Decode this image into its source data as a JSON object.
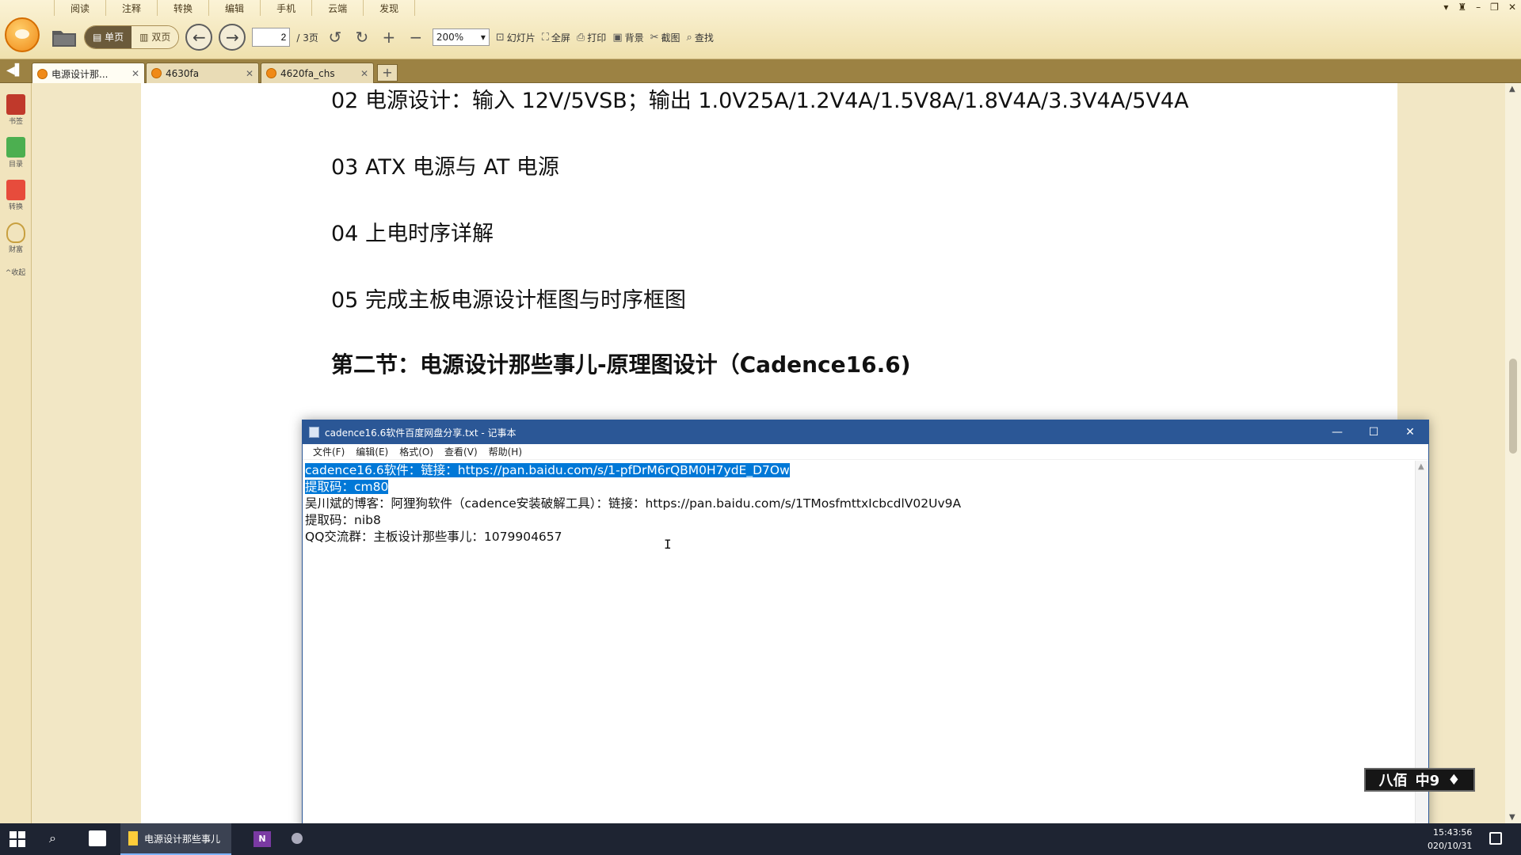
{
  "reader": {
    "menu": [
      "阅读",
      "注释",
      "转换",
      "编辑",
      "手机",
      "云端",
      "发现"
    ],
    "toolbar": {
      "single_page": "单页",
      "double_page": "双页",
      "page_current": "2",
      "page_total": "/ 3页",
      "zoom": "200%",
      "slideshow": "幻灯片",
      "fullscreen": "全屏",
      "print": "打印",
      "background": "背景",
      "screenshot": "截图",
      "find": "查找"
    },
    "tabs": [
      {
        "label": "电源设计那..."
      },
      {
        "label": "4630fa"
      },
      {
        "label": "4620fa_chs"
      }
    ],
    "tab_add": "+",
    "sidebar": [
      {
        "label": "书签",
        "color": "#c0392b"
      },
      {
        "label": "目录",
        "color": "#4caf50"
      },
      {
        "label": "转换",
        "color": "#e74c3c"
      },
      {
        "label": "财富",
        "color": "#c8a040"
      }
    ],
    "sidebar_collapse": "^收起"
  },
  "document": {
    "lines": [
      "02 电源设计：输入 12V/5VSB；输出 1.0V25A/1.2V4A/1.5V8A/1.8V4A/3.3V4A/5V4A",
      "03 ATX 电源与 AT 电源",
      "04 上电时序详解",
      "05 完成主板电源设计框图与时序框图",
      "第二节：电源设计那些事儿-原理图设计（Cadence16.6)"
    ]
  },
  "notepad": {
    "title": "cadence16.6软件百度网盘分享.txt - 记事本",
    "menu": [
      "文件(F)",
      "编辑(E)",
      "格式(O)",
      "查看(V)",
      "帮助(H)"
    ],
    "lines": [
      "cadence16.6软件：链接：https://pan.baidu.com/s/1-pfDrM6rQBM0H7ydE_D7Ow",
      "提取码：cm80",
      "吴川斌的博客：阿狸狗软件（cadence安装破解工具）：链接：https://pan.baidu.com/s/1TMosfmttxIcbcdlV02Uv9A",
      "提取码：nib8",
      "QQ交流群：主板设计那些事儿：1079904657"
    ],
    "colors": {
      "titlebar": "#2b5796",
      "selection": "#0078d7"
    }
  },
  "watermark": {
    "left": "八佰",
    "right": "中9"
  },
  "taskbar": {
    "foxit_label": "电源设计那些事儿",
    "onenote": "N",
    "time": "15:43:56",
    "date": "020/10/31"
  }
}
